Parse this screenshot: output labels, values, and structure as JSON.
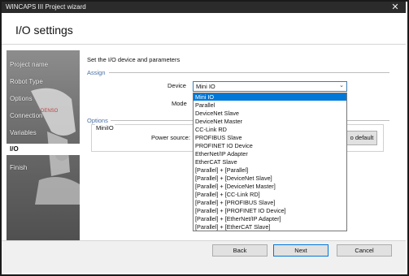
{
  "window": {
    "title": "WINCAPS III Project wizard",
    "close_glyph": "✕"
  },
  "header": {
    "title": "I/O settings"
  },
  "sidebar": {
    "items": [
      {
        "label": "Project name"
      },
      {
        "label": "Robot Type"
      },
      {
        "label": "Options"
      },
      {
        "label": "Connection"
      },
      {
        "label": "Variables"
      },
      {
        "label": "I/O"
      },
      {
        "label": "Finish"
      }
    ],
    "selected_index": 5
  },
  "main": {
    "instruction": "Set the I/O device and parameters",
    "assign_section": "Assign",
    "device_label": "Device",
    "device_value": "Mini IO",
    "mode_label": "Mode",
    "options_section": "Options",
    "group_label": "MiniIO",
    "power_source_label": "Power source:",
    "default_button_partial": "o default"
  },
  "dropdown": {
    "options": [
      "Mini IO",
      "Parallel",
      "DeviceNet Slave",
      "DeviceNet Master",
      "CC-Link RD",
      "PROFIBUS Slave",
      "PROFINET IO Device",
      "EtherNet/IP Adapter",
      "EtherCAT Slave",
      "[Parallel] + [Parallel]",
      "[Parallel] + [DeviceNet Slave]",
      "[Parallel] + [DeviceNet Master]",
      "[Parallel] + [CC-Link RD]",
      "[Parallel] + [PROFIBUS Slave]",
      "[Parallel] + [PROFINET IO Device]",
      "[Parallel] + [EtherNet/IP Adapter]",
      "[Parallel] + [EtherCAT Slave]"
    ],
    "selected_index": 0
  },
  "footer": {
    "back_label": "Back",
    "next_label": "Next",
    "cancel_label": "Cancel"
  },
  "colors": {
    "titlebar": "#2b2b2b",
    "accent": "#0078d7",
    "section": "#4a6fa5"
  }
}
